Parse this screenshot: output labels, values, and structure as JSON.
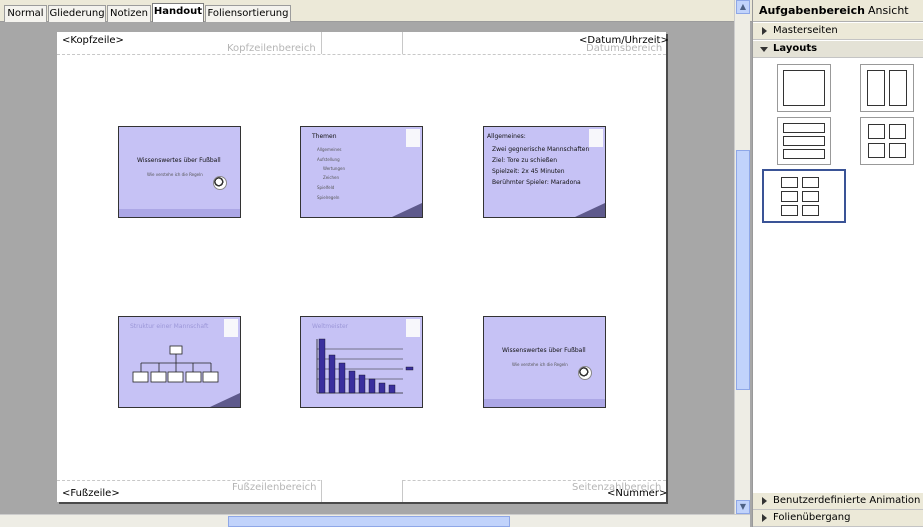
{
  "tabs": [
    {
      "label": "Normal"
    },
    {
      "label": "Gliederung"
    },
    {
      "label": "Notizen"
    },
    {
      "label": "Handout"
    },
    {
      "label": "Foliensortierung"
    }
  ],
  "handout": {
    "header_placeholder": "<Kopfzeile>",
    "header_area": "Kopfzeilenbereich",
    "date_placeholder": "<Datum/Uhrzeit>",
    "date_area": "Datumsbereich",
    "footer_placeholder": "<Fußzeile>",
    "footer_area": "Fußzeilenbereich",
    "number_placeholder": "<Nummer>",
    "number_area": "Seitenzahlbereich"
  },
  "slides": [
    {
      "title": "Wissenswertes über Fußball",
      "subtitle": "Wie verstehe ich die Regeln"
    },
    {
      "title": "Themen",
      "bullets": [
        "Allgemeines",
        "Aufstellung",
        "Wertungen",
        "Zeichen",
        "Spielfeld",
        "Spielregeln"
      ]
    },
    {
      "title": "Allgemeines:",
      "bullets": [
        "Zwei gegnerische Mannschaften",
        "Ziel: Tore zu schießen",
        "Spielzeit: 2x 45 Minuten",
        "Berühmter Spieler: Maradona"
      ]
    },
    {
      "title": "Struktur einer Mannschaft"
    },
    {
      "title": "Weltmeister"
    },
    {
      "title": "Wissenswertes über Fußball",
      "subtitle": "Wie verstehe ich die Regeln"
    }
  ],
  "task_pane": {
    "title": "Aufgabenbereich",
    "view_label": "Ansicht",
    "sections": {
      "masters": "Masterseiten",
      "layouts": "Layouts",
      "custom_animation": "Benutzerdefinierte Animation",
      "transition": "Folienübergang"
    }
  }
}
